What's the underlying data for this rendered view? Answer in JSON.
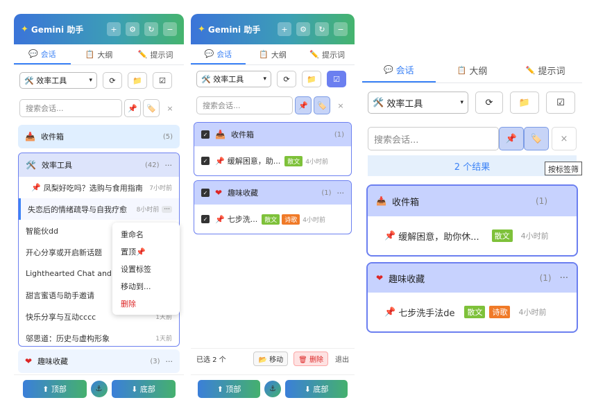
{
  "app": {
    "title": "Gemini 助手"
  },
  "tabs": [
    {
      "label": "会话"
    },
    {
      "label": "大纲"
    },
    {
      "label": "提示词"
    }
  ],
  "toolbar": {
    "selected_group": "效率工具"
  },
  "search": {
    "placeholder": "搜索会话..."
  },
  "panel1": {
    "folders": {
      "inbox": {
        "name": "收件箱",
        "count": "(5)"
      },
      "efficiency": {
        "name": "效率工具",
        "count": "(42)",
        "more": "···"
      },
      "fun": {
        "name": "趣味收藏",
        "count": "(3)",
        "more": "···"
      }
    },
    "items": [
      {
        "title": "凤梨好吃吗？选购与食用指南",
        "time": "7小时前",
        "pinned": true
      },
      {
        "title": "失恋后的情绪疏导与自我疗愈",
        "time": "8小时前",
        "more": "···"
      },
      {
        "title": "智能伙dd",
        "time": ""
      },
      {
        "title": "开心分享或开启新话题",
        "time": ""
      },
      {
        "title": "Lighthearted Chat and C",
        "time": ""
      },
      {
        "title": "甜言蜜语与助手邀请",
        "time": ""
      },
      {
        "title": "快乐分享与互动cccc",
        "time": "1天前"
      },
      {
        "title": "邬思道：历史与虚构形象",
        "time": "1天前"
      }
    ],
    "context_menu": [
      "重命名",
      "置顶📌",
      "设置标签",
      "移动到...",
      "删除"
    ],
    "bottom": {
      "top": "⬆ 顶部",
      "bottom": "⬇ 底部"
    }
  },
  "panel2": {
    "folders": {
      "inbox": {
        "name": "收件箱",
        "count": "(1)"
      },
      "fun": {
        "name": "趣味收藏",
        "count": "(1)",
        "more": "···"
      }
    },
    "items": [
      {
        "title": "缓解困意，助...",
        "tags": [
          "散文"
        ],
        "time": "4小时前"
      },
      {
        "title": "七步洗...",
        "tags": [
          "散文",
          "诗歌"
        ],
        "time": "4小时前"
      }
    ],
    "batch": {
      "selected": "已选 2 个",
      "move": "移动",
      "delete": "删除",
      "exit": "退出"
    }
  },
  "panel3": {
    "results": "2 个结果",
    "tooltip": "按标签筛",
    "folders": {
      "inbox": {
        "name": "收件箱",
        "count": "(1)"
      },
      "fun": {
        "name": "趣味收藏",
        "count": "(1)",
        "more": "···"
      }
    },
    "items": [
      {
        "title": "缓解困意，助你休...",
        "tags": [
          "散文"
        ],
        "time": "4小时前"
      },
      {
        "title": "七步洗手法de",
        "tags": [
          "散文",
          "诗歌"
        ],
        "time": "4小时前"
      }
    ]
  },
  "colors": {
    "accent": "#3b82f6",
    "folder_bg": "#dbeafe",
    "selected_folder": "#c7d2fe",
    "tag_green": "#7ec13a",
    "tag_orange": "#f07a28"
  }
}
